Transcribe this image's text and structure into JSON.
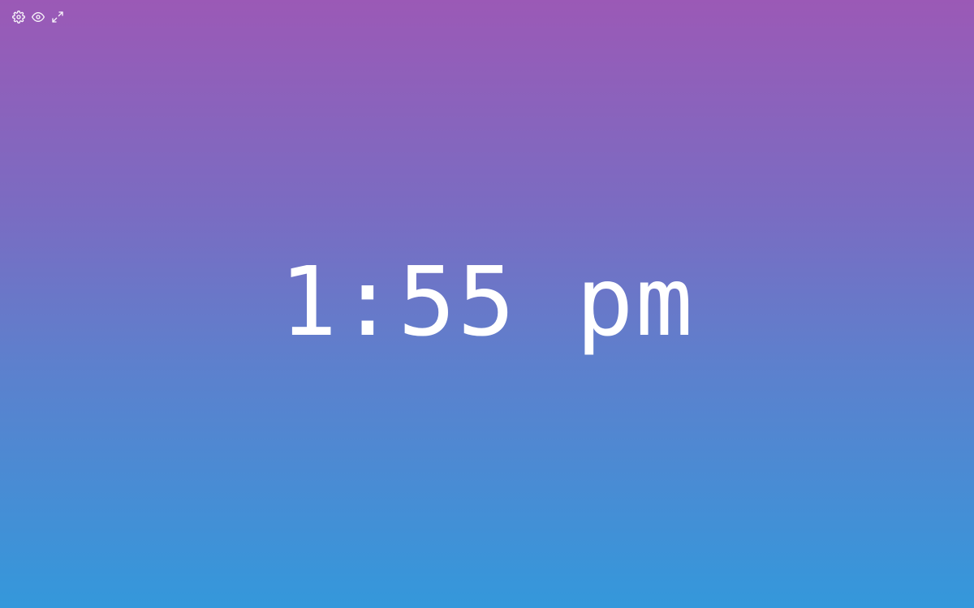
{
  "toolbar": {
    "items": [
      {
        "icon": "settings-icon"
      },
      {
        "icon": "eye-icon"
      },
      {
        "icon": "fullscreen-icon"
      }
    ]
  },
  "clock": {
    "time": "1:55 pm"
  },
  "colors": {
    "gradient_top": "#9b59b6",
    "gradient_bottom": "#3498db",
    "text": "#ffffff"
  }
}
